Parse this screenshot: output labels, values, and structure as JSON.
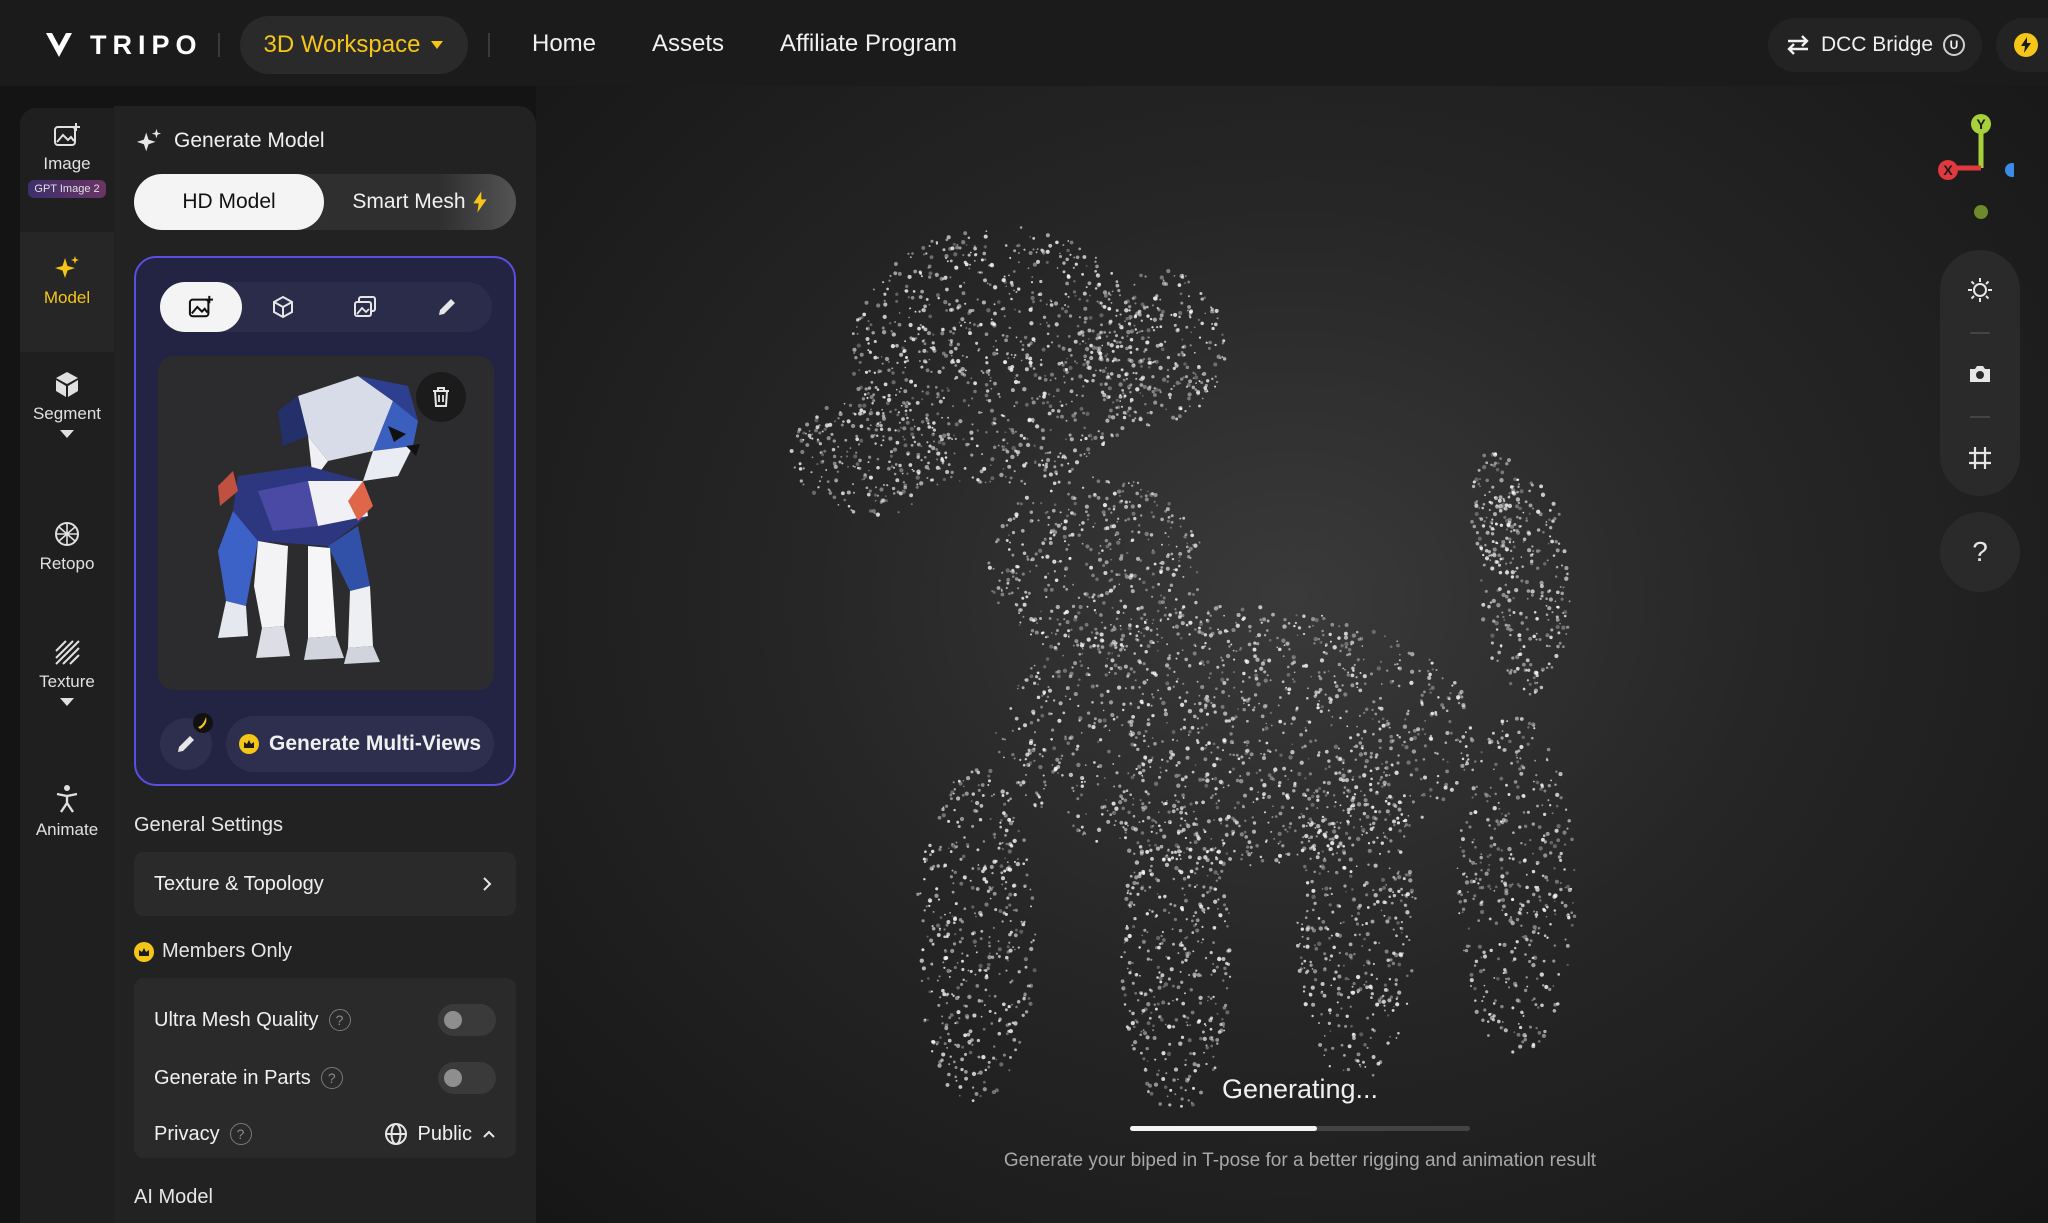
{
  "topbar": {
    "logo": "TRIPO",
    "workspace": "3D Workspace",
    "nav": [
      "Home",
      "Assets",
      "Affiliate Program"
    ],
    "dcc_bridge": "DCC Bridge",
    "unreal_badge": "U"
  },
  "rail": {
    "image": "Image",
    "image_badge": "GPT Image 2",
    "model": "Model",
    "segment": "Segment",
    "retopo": "Retopo",
    "texture": "Texture",
    "animate": "Animate"
  },
  "panel": {
    "title": "Generate Model",
    "mode_hd": "HD Model",
    "mode_smart": "Smart Mesh",
    "generate_multiviews": "Generate Multi-Views",
    "general_settings": "General Settings",
    "texture_topology": "Texture & Topology",
    "members_only": "Members Only",
    "ultra_mesh": "Ultra Mesh Quality",
    "generate_parts": "Generate in Parts",
    "privacy": "Privacy",
    "privacy_value": "Public",
    "ai_model": "AI Model",
    "help_mark": "?"
  },
  "viewport": {
    "status": "Generating...",
    "hint": "Generate your biped in T-pose for a better rigging and animation result",
    "progress": 0.55,
    "axis_x": "X",
    "axis_y": "Y",
    "help": "?"
  },
  "colors": {
    "accent": "#f5c518",
    "card_border": "#5a4fe0",
    "axis_x": "#e0393e",
    "axis_y": "#a6d13a",
    "axis_z": "#3b8be8"
  }
}
